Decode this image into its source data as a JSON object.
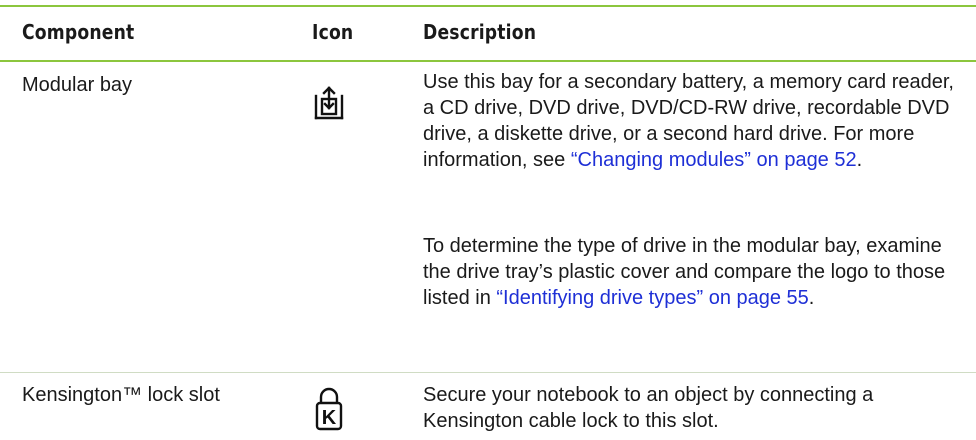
{
  "table": {
    "headers": {
      "component": "Component",
      "icon": "Icon",
      "description": "Description"
    },
    "rows": [
      {
        "component": "Modular bay",
        "icon": "modular-bay-icon",
        "paragraphs": [
          {
            "text": "Use this bay for a secondary battery, a memory card reader, a CD drive, DVD drive, DVD/CD-RW drive, recordable DVD drive, a diskette drive, or a second hard drive. For more information, see ",
            "link": "“Changing modules” on page 52",
            "after": "."
          },
          {
            "text": "To determine the type of drive in the modular bay, examine the drive tray’s plastic cover and compare the logo to those listed in ",
            "link": "“Identifying drive types” on page 55",
            "after": "."
          }
        ]
      },
      {
        "component": "Kensington™ lock slot",
        "icon": "kensington-lock-icon",
        "icon_letter": "K",
        "paragraphs": [
          {
            "text": "Secure your notebook to an object by connecting a Kensington cable lock to this slot."
          }
        ]
      }
    ]
  },
  "colors": {
    "rule": "#8cc63e",
    "link": "#1e2fd6"
  }
}
